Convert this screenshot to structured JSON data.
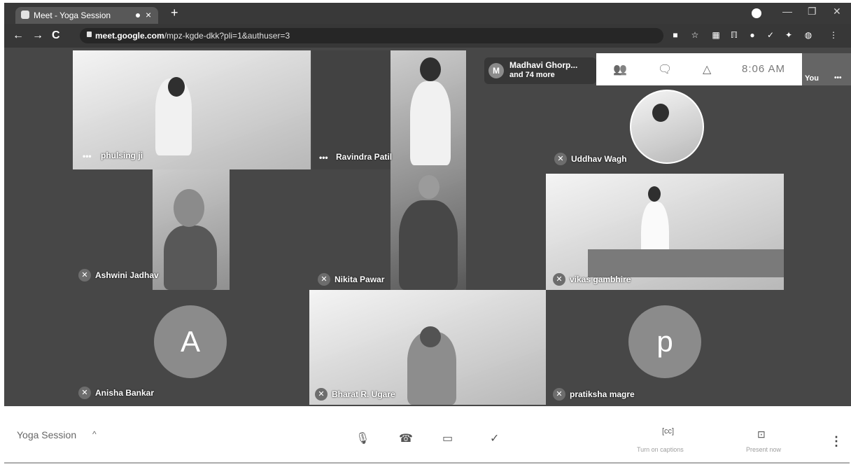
{
  "browser": {
    "tab_title": "Meet - Yoga Session",
    "tab_close": "×",
    "new_tab": "+",
    "url_host": "meet.google.com",
    "url_path": "/mpz-kgde-dkk?pli=1&authuser=3",
    "nav": {
      "back": "←",
      "forward": "→",
      "reload": "C"
    },
    "win_minimize": "—",
    "win_restore": "❐",
    "win_close": "✕",
    "extensions": [
      "■",
      "☆",
      "▦",
      "ℿ",
      "●",
      "✓",
      "✦",
      "◍",
      "⋮"
    ]
  },
  "meet": {
    "participants_summary": {
      "initial": "M",
      "line1": "Madhavi Ghorp...",
      "line2": "and 74 more"
    },
    "top_controls": {
      "icons": [
        "people-icon",
        "chat-icon",
        "activities-icon"
      ],
      "glyphs": [
        "👥",
        "🗨",
        "△"
      ],
      "clock": "8:06 AM"
    },
    "self": {
      "label": "You",
      "more": "•••"
    },
    "tiles": [
      {
        "name": "phulsing ji",
        "status": "•••"
      },
      {
        "name": "Ravindra Patil",
        "status": "•••"
      },
      {
        "name": "Uddhav Wagh",
        "status": "mic-off"
      },
      {
        "name": "Ashwini Jadhav",
        "status": "mic-off"
      },
      {
        "name": "Nikita Pawar",
        "status": "mic-off"
      },
      {
        "name": "vikas gambhire",
        "status": "mic-off"
      },
      {
        "name": "Anisha Bankar",
        "status": "mic-off",
        "avatar_letter": "A"
      },
      {
        "name": "Bharat R. Ugare",
        "status": "mic-off"
      },
      {
        "name": "pratiksha magre",
        "status": "mic-off",
        "avatar_letter": "p"
      }
    ],
    "mic_off_glyph": "✕"
  },
  "bottom_bar": {
    "meeting_name": "Yoga Session",
    "chevron": "^",
    "controls": {
      "mic": "🎙",
      "hangup": "☎",
      "camera": "▭",
      "check": "✓"
    },
    "captions_label": "Turn on captions",
    "captions_glyph": "[cc]",
    "present_label": "Present now",
    "present_glyph": "⊡",
    "more": "⋮"
  }
}
